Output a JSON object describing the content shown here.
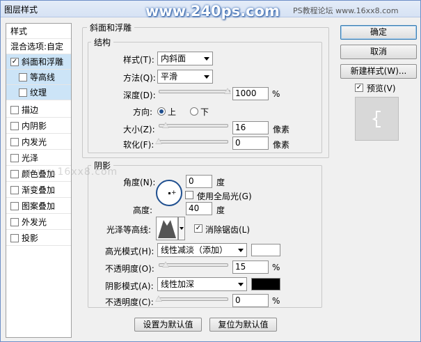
{
  "window": {
    "title": "图层样式"
  },
  "watermarks": {
    "site": "www.240ps.com",
    "forum": "PS教程论坛 www.16xx8.com",
    "overlay": "www.16xx8.com"
  },
  "sidebar": {
    "header": "样式",
    "blend_options": "混合选项:自定",
    "items": [
      {
        "label": "斜面和浮雕",
        "checked": true
      },
      {
        "label": "等高线",
        "checked": false
      },
      {
        "label": "纹理",
        "checked": false
      },
      {
        "label": "描边",
        "checked": false
      },
      {
        "label": "内阴影",
        "checked": false
      },
      {
        "label": "内发光",
        "checked": false
      },
      {
        "label": "光泽",
        "checked": false
      },
      {
        "label": "颜色叠加",
        "checked": false
      },
      {
        "label": "渐变叠加",
        "checked": false
      },
      {
        "label": "图案叠加",
        "checked": false
      },
      {
        "label": "外发光",
        "checked": false
      },
      {
        "label": "投影",
        "checked": false
      }
    ]
  },
  "bevel": {
    "group_title": "斜面和浮雕",
    "structure_title": "结构",
    "style_label": "样式(T):",
    "style_value": "内斜面",
    "technique_label": "方法(Q):",
    "technique_value": "平滑",
    "depth_label": "深度(D):",
    "depth_value": "1000",
    "depth_unit": "%",
    "direction_label": "方向:",
    "dir_up": "上",
    "dir_down": "下",
    "size_label": "大小(Z):",
    "size_value": "16",
    "size_unit": "像素",
    "soften_label": "软化(F):",
    "soften_value": "0",
    "soften_unit": "像素"
  },
  "shading": {
    "title": "阴影",
    "angle_label": "角度(N):",
    "angle_value": "0",
    "angle_unit": "度",
    "global_light_label": "使用全局光(G)",
    "altitude_label": "高度:",
    "altitude_value": "40",
    "altitude_unit": "度",
    "gloss_label": "光泽等高线:",
    "antialias_label": "消除锯齿(L)",
    "highlight_mode_label": "高光模式(H):",
    "highlight_mode_value": "线性减淡（添加）",
    "highlight_color": "#ffffff",
    "highlight_opacity_label": "不透明度(O):",
    "highlight_opacity_value": "15",
    "highlight_opacity_unit": "%",
    "shadow_mode_label": "阴影模式(A):",
    "shadow_mode_value": "线性加深",
    "shadow_color": "#000000",
    "shadow_opacity_label": "不透明度(C):",
    "shadow_opacity_value": "0",
    "shadow_opacity_unit": "%"
  },
  "footer": {
    "make_default": "设置为默认值",
    "reset_default": "复位为默认值"
  },
  "right": {
    "ok": "确定",
    "cancel": "取消",
    "new_style": "新建样式(W)...",
    "preview": "预览(V)"
  }
}
